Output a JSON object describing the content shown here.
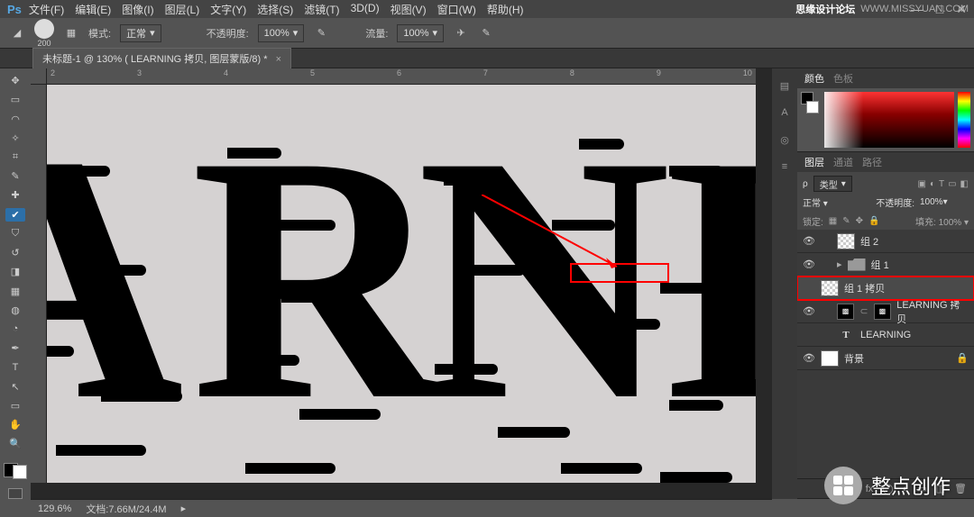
{
  "watermark_top": {
    "label": "思缘设计论坛",
    "url": "WWW.MISSYUAN.COM"
  },
  "menu": {
    "items": [
      "文件(F)",
      "编辑(E)",
      "图像(I)",
      "图层(L)",
      "文字(Y)",
      "选择(S)",
      "滤镜(T)",
      "3D(D)",
      "视图(V)",
      "窗口(W)",
      "帮助(H)"
    ]
  },
  "optionbar": {
    "brush_size": "200",
    "mode_label": "模式:",
    "mode_value": "正常",
    "opacity_label": "不透明度:",
    "opacity_value": "100%",
    "flow_label": "流量:",
    "flow_value": "100%"
  },
  "tab": {
    "title": "未标题-1 @ 130% ( LEARNING 拷贝, 图层蒙版/8) *"
  },
  "tools": [
    "↖",
    "▭",
    "◌",
    "✂",
    "✎",
    "▤",
    "✔",
    "✒",
    "⌫",
    "◆",
    "△",
    "◍",
    "●",
    "T",
    "↘",
    "✋",
    "🔍"
  ],
  "ruler_h": [
    "2",
    "3",
    "4",
    "5",
    "6",
    "7",
    "8",
    "9",
    "10"
  ],
  "panels": {
    "color": {
      "tabs": [
        "颜色",
        "色板"
      ],
      "active": 0
    },
    "layers": {
      "tabs": [
        "图层",
        "通道",
        "路径"
      ],
      "active": 0,
      "kind_label": "类型",
      "blend_mode": "正常",
      "opacity_label": "不透明度:",
      "opacity_value": "100%",
      "lock_label": "锁定:",
      "fill_label": "填充:",
      "fill_value": "100%",
      "items": [
        {
          "eye": true,
          "type": "thumb",
          "name": "组 2",
          "indent": 1
        },
        {
          "eye": true,
          "type": "folder",
          "name": "组 1",
          "indent": 1
        },
        {
          "eye": false,
          "type": "thumb",
          "name": "组 1 拷贝",
          "indent": 0,
          "highlight": true
        },
        {
          "eye": true,
          "type": "mask",
          "name": "LEARNING 拷贝",
          "indent": 1
        },
        {
          "eye": false,
          "type": "text",
          "name": "LEARNING",
          "indent": 1
        },
        {
          "eye": true,
          "type": "solid",
          "name": "背景",
          "indent": 0,
          "locked": true
        }
      ]
    }
  },
  "status": {
    "zoom": "129.6%",
    "doc_label": "文档:",
    "doc_value": "7.66M/24.4M"
  },
  "watermark_bottom": "整点创作"
}
